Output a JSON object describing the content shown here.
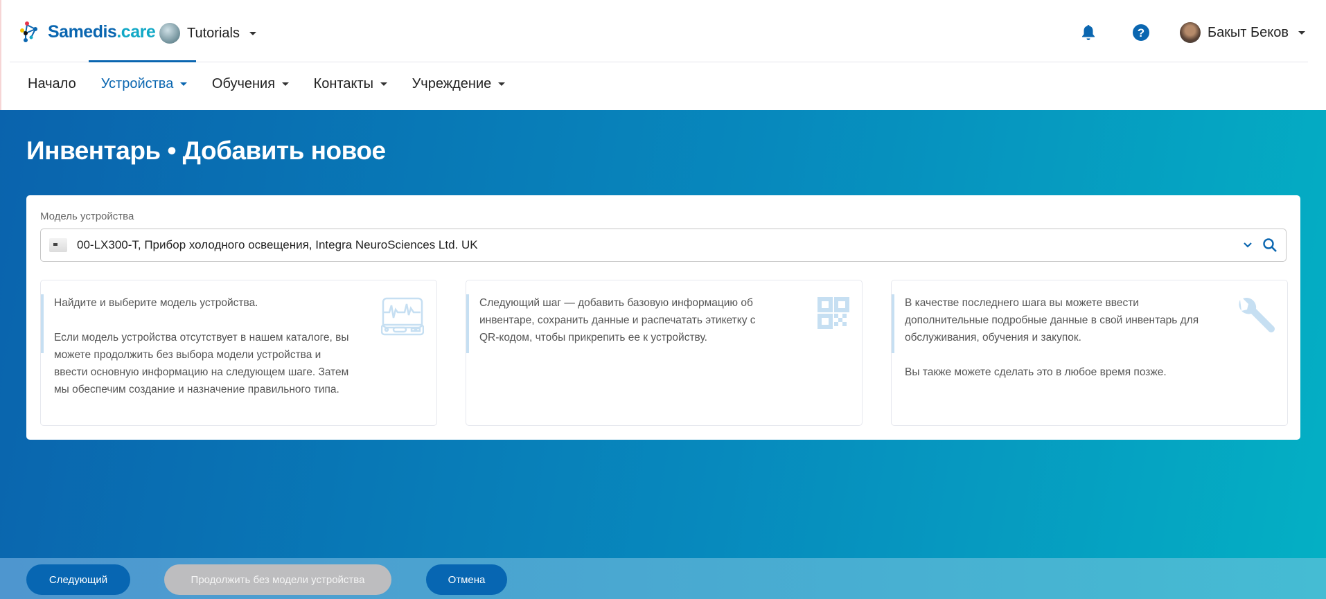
{
  "header": {
    "logo": {
      "main": "Samedis",
      "suffix": ".care"
    },
    "organization": "Tutorials",
    "user_name": "Бакыт Беков"
  },
  "nav": {
    "items": [
      {
        "label": "Начало",
        "active": false,
        "dropdown": false
      },
      {
        "label": "Устройства",
        "active": true,
        "dropdown": true
      },
      {
        "label": "Обучения",
        "active": false,
        "dropdown": true
      },
      {
        "label": "Контакты",
        "active": false,
        "dropdown": true
      },
      {
        "label": "Учреждение",
        "active": false,
        "dropdown": true
      }
    ]
  },
  "page": {
    "title": "Инвентарь • Добавить новое"
  },
  "form": {
    "device_model_label": "Модель устройства",
    "device_model_value": "00-LX300-T, Прибор холодного освещения, Integra NeuroSciences Ltd. UK"
  },
  "info_cards": [
    {
      "icon": "monitor-icon",
      "text": "Найдите и выберите модель устройства.\n\nЕсли модель устройства отсутствует в нашем каталоге, вы можете продолжить без выбора модели устройства и ввести основную информацию на следующем шаге. Затем мы обеспечим создание и назначение правильного типа."
    },
    {
      "icon": "qr-code-icon",
      "text": "Следующий шаг — добавить базовую информацию об инвентаре, сохранить данные и распечатать этикетку с QR-кодом, чтобы прикрепить ее к устройству."
    },
    {
      "icon": "wrench-icon",
      "text": "В качестве последнего шага вы можете ввести дополнительные подробные данные в свой инвентарь для обслуживания, обучения и закупок.\n\nВы также можете сделать это в любое время позже."
    }
  ],
  "footer": {
    "next": "Следующий",
    "continue_without": "Продолжить без модели устройства",
    "cancel": "Отмена"
  },
  "colors": {
    "brand": "#0a66b0",
    "accent": "#11a8c6"
  }
}
